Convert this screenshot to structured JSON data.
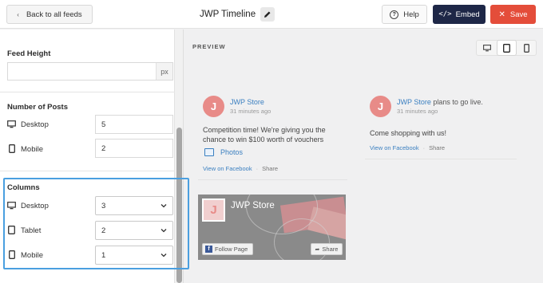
{
  "header": {
    "back_label": "Back to all feeds",
    "feed_title": "JWP Timeline",
    "help_label": "Help",
    "embed_label": "Embed",
    "save_label": "Save",
    "embed_color": "#1e2747",
    "save_color": "#e44d3a"
  },
  "sidebar": {
    "feed_height": {
      "label": "Feed Height",
      "value": "",
      "unit": "px"
    },
    "number_of_posts": {
      "label": "Number of Posts",
      "desktop_label": "Desktop",
      "desktop_value": "5",
      "mobile_label": "Mobile",
      "mobile_value": "2"
    },
    "columns": {
      "label": "Columns",
      "desktop_label": "Desktop",
      "desktop_value": "3",
      "tablet_label": "Tablet",
      "tablet_value": "2",
      "mobile_label": "Mobile",
      "mobile_value": "1"
    },
    "highlight_color": "#4a9fe0"
  },
  "preview": {
    "label": "PREVIEW",
    "device_toggle": [
      "desktop-icon",
      "tablet-icon",
      "mobile-icon"
    ],
    "active_device": "tablet",
    "post1": {
      "avatar_letter": "J",
      "author": "JWP Store",
      "time": "31 minutes ago",
      "text": "Competition time! We're giving you the chance to win $100 worth of vouchers",
      "photos_label": "Photos",
      "view_label": "View on Facebook",
      "share_label": "Share"
    },
    "post2": {
      "avatar_letter": "J",
      "author": "JWP Store",
      "author_rest": " plans to go live.",
      "time": "31 minutes ago",
      "text": "Come shopping with us!",
      "view_label": "View on Facebook",
      "share_label": "Share"
    },
    "page_card": {
      "avatar_letter": "J",
      "name": "JWP Store",
      "follow_label": "Follow Page",
      "share_label": "Share"
    }
  }
}
